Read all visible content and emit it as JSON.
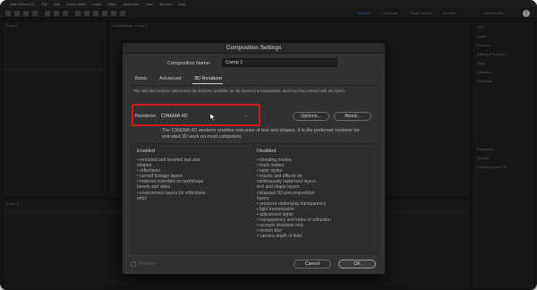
{
  "menubar": {
    "app_name": "After Effects CC",
    "items": [
      "File",
      "Edit",
      "Composition",
      "Layer",
      "Effect",
      "Animation",
      "View",
      "Window",
      "Help"
    ]
  },
  "toolbar": {
    "workspace_active": "Default",
    "workspaces": [
      "Standard",
      "Small Screen",
      "Libraries"
    ],
    "search_placeholder": "Search Help"
  },
  "left_panel": {
    "tab": "Project"
  },
  "comp_panel": {
    "tab": "Composition: Comp 1"
  },
  "right_panel": {
    "items": [
      "Info",
      "Audio",
      "Preview",
      "Effects & Presets",
      "Align",
      "Libraries",
      "Character",
      "Paragraph",
      "Tracker",
      "Content-Aware Fill"
    ]
  },
  "timeline": {
    "tab": "Comp 1"
  },
  "dialog": {
    "title": "Composition Settings",
    "composition_name_label": "Composition Name:",
    "composition_name_value": "Comp 1",
    "tabs": [
      "Basic",
      "Advanced",
      "3D Renderer"
    ],
    "active_tab": "3D Renderer",
    "description": "The selected renderer determines the features available for 3D layers in a composition, and how they interact with 2D layers.",
    "renderer_label": "Renderer:",
    "renderer_value": "CINEMA 4D",
    "options_button": "Options...",
    "about_button": "About...",
    "renderer_info": "The CINEMA 4D renderer enables extrusion of text and shapes. It is the preferred renderer for extruded 3D work on most computers.",
    "enabled_heading": "Enabled",
    "enabled_items": [
      "• extruded and beveled text and",
      "   shapes",
      "• reflections",
      "• curved footage layers",
      "• material overrides on text/shape",
      "   bevels and sides",
      "• environment layers (in reflections",
      "   only)"
    ],
    "disabled_heading": "Disabled",
    "disabled_items": [
      "• blending modes",
      "• track mattes",
      "• layer styles",
      "• masks and effects on:",
      "        continuously rasterized layers",
      "        text and shape layers",
      "        collapsed 3D precomposition",
      "layers",
      "• preserve underlying transparency",
      "• light transmission",
      "• adjustment lights",
      "• transparency and index of refraction",
      "• accepts shadows only",
      "• motion blur",
      "• camera depth of field"
    ],
    "preview_label": "Preview",
    "cancel_button": "Cancel",
    "ok_button": "OK"
  },
  "colors": {
    "highlight_box": "#d3171b",
    "dialog_bg": "#323232",
    "app_bg": "#1f1f1f"
  }
}
